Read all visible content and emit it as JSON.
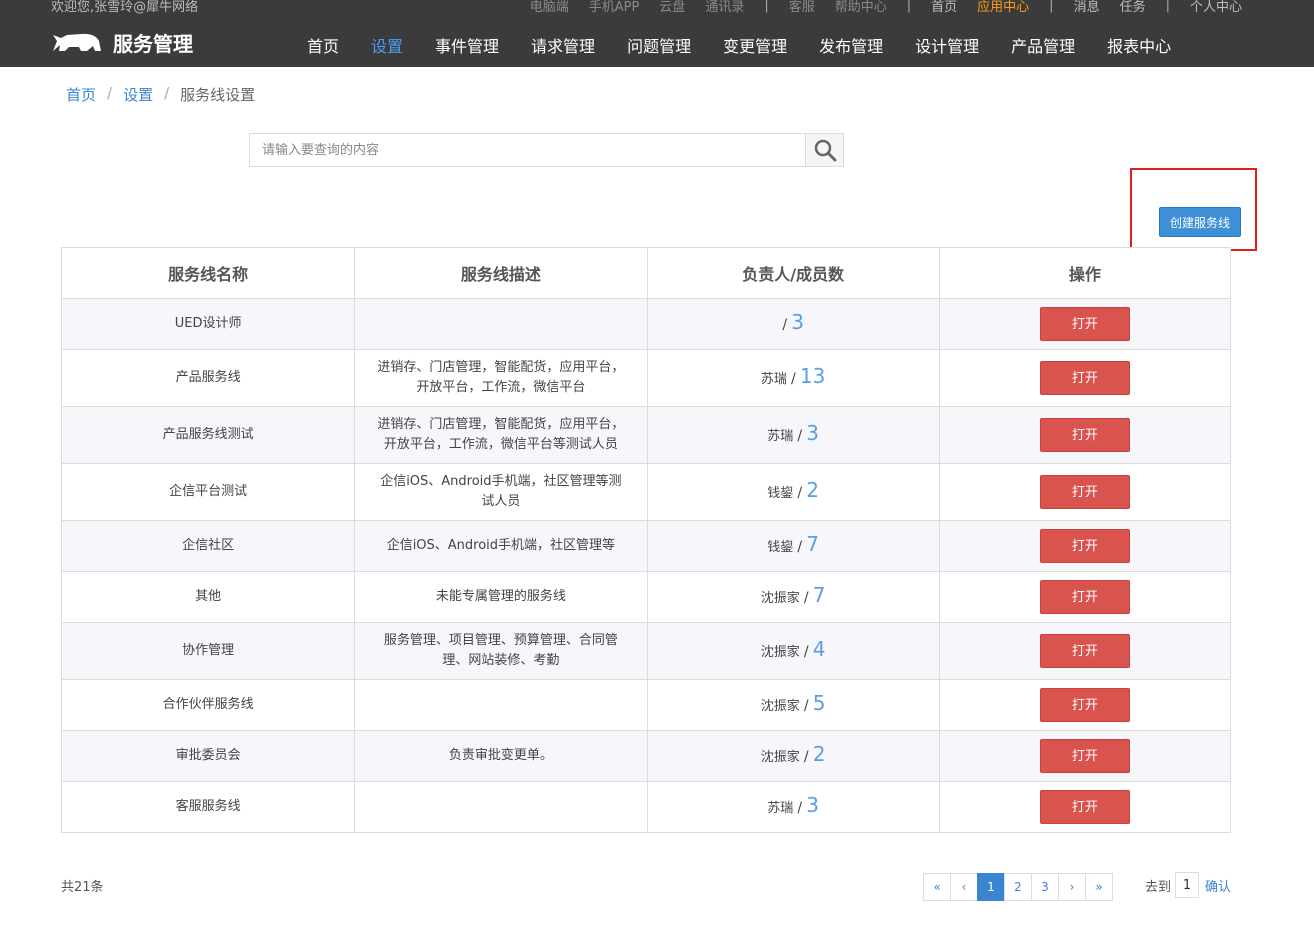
{
  "header": {
    "welcome": "欢迎您,张雪玲@犀牛网络",
    "top_links": [
      {
        "label": "电脑端"
      },
      {
        "label": "手机APP"
      },
      {
        "label": "云盘"
      },
      {
        "label": "通讯录"
      },
      {
        "label": "客服"
      },
      {
        "label": "帮助中心"
      },
      {
        "label": "首页"
      },
      {
        "label": "应用中心"
      },
      {
        "label": "消息"
      },
      {
        "label": "任务"
      },
      {
        "label": "个人中心"
      }
    ],
    "app_title": "服务管理",
    "logo_icon": "rhino-logo-icon",
    "nav": [
      "首页",
      "设置",
      "事件管理",
      "请求管理",
      "问题管理",
      "变更管理",
      "发布管理",
      "设计管理",
      "产品管理",
      "报表中心"
    ],
    "nav_active": "设置",
    "accent_active": "#ff9a1a",
    "bg_color": "#3b3b3b"
  },
  "breadcrumb": {
    "home": "首页",
    "settings": "设置",
    "current": "服务线设置",
    "separator": "/"
  },
  "search": {
    "placeholder": "请输入要查询的内容",
    "value": "",
    "icon": "search-icon"
  },
  "create_button": "创建服务线",
  "table": {
    "headers": [
      "服务线名称",
      "服务线描述",
      "负责人/成员数",
      "操作"
    ],
    "rows": [
      {
        "name": "UED设计师",
        "desc": "",
        "owner": "",
        "count": "3",
        "action": "打开"
      },
      {
        "name": "产品服务线",
        "desc": "进销存、门店管理，智能配货，应用平台，开放平台，工作流，微信平台",
        "owner": "苏瑞",
        "count": "13",
        "action": "打开"
      },
      {
        "name": "产品服务线测试",
        "desc": "进销存、门店管理，智能配货，应用平台，开放平台，工作流，微信平台等测试人员",
        "owner": "苏瑞",
        "count": "3",
        "action": "打开"
      },
      {
        "name": "企信平台测试",
        "desc": "企信iOS、Android手机端，社区管理等测试人员",
        "owner": "钱鋆",
        "count": "2",
        "action": "打开"
      },
      {
        "name": "企信社区",
        "desc": "企信iOS、Android手机端，社区管理等",
        "owner": "钱鋆",
        "count": "7",
        "action": "打开"
      },
      {
        "name": "其他",
        "desc": "未能专属管理的服务线",
        "owner": "沈振家",
        "count": "7",
        "action": "打开"
      },
      {
        "name": "协作管理",
        "desc": "服务管理、项目管理、预算管理、合同管理、网站装修、考勤",
        "owner": "沈振家",
        "count": "4",
        "action": "打开"
      },
      {
        "name": "合作伙伴服务线",
        "desc": "",
        "owner": "沈振家",
        "count": "5",
        "action": "打开"
      },
      {
        "name": "审批委员会",
        "desc": "负责审批变更单。",
        "owner": "沈振家",
        "count": "2",
        "action": "打开"
      },
      {
        "name": "客服服务线",
        "desc": "",
        "owner": "苏瑞",
        "count": "3",
        "action": "打开"
      }
    ]
  },
  "footer": {
    "total": "共21条",
    "pager": [
      "«",
      "‹",
      "1",
      "2",
      "3",
      "›",
      "»"
    ],
    "current_page": "1",
    "goto_label": "去到",
    "goto_value": "1",
    "confirm": "确认"
  },
  "colors": {
    "primary": "#3a85d0",
    "danger": "#d9534f",
    "highlight": "#e02020"
  }
}
